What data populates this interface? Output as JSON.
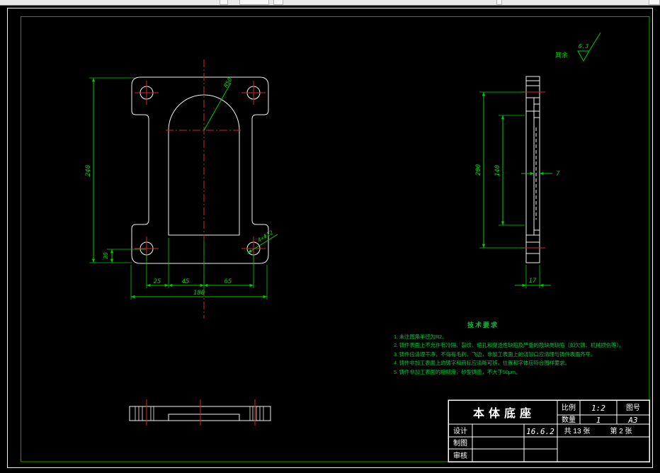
{
  "colors": {
    "background": "#000000",
    "outline_white": "#f2f2f2",
    "dimension_green": "#00cc00",
    "centerline_red": "#cc2929",
    "notes_green": "#00c43a",
    "frame_green": "#00a800",
    "title_text": "#ffffff"
  },
  "roughness": {
    "label": "其余",
    "value": "6.3"
  },
  "front_view": {
    "dim_height": "240",
    "dim_base": "20",
    "dim_chain": [
      "25",
      "45",
      "65"
    ],
    "dim_total": "180",
    "radius_label": "R50",
    "holes_label": "4×Φ12"
  },
  "side_view": {
    "dim_span": "200",
    "dim_notch": "140",
    "dim_web": "7",
    "dim_thickness": "17"
  },
  "notes": {
    "title": "技术要求",
    "items": [
      "1. 未注圆角半径为R2。",
      "2. 铸件表面上不允许有冷隔、裂纹、缩孔和穿透性缺陷及严重的残缺类缺陷（如欠铸、机械损伤等）。",
      "3. 铸件应清理干净，不得有毛刺、飞边，非加工表面上的浇冒口应清理与铸件表面齐平。",
      "4. 铸件非加工表面上的铸字和商标应清晰可辨，位置和字体应符合图样要求。",
      "5. 铸件非加工表面的粗糙度，砂型铸造，不大于50μm。"
    ]
  },
  "title_block": {
    "part_name": "本体底座",
    "scale_label": "比例",
    "scale_value": "1:2",
    "qty_label": "数量",
    "qty_value": "1",
    "drawing_no_label": "图号",
    "sheet_size": "A3",
    "design_label": "设计",
    "date": "16.6.2",
    "sheets_total": "共 13 张",
    "sheet_index": "第 2 张",
    "draft_label": "制图",
    "audit_label": "审核"
  }
}
